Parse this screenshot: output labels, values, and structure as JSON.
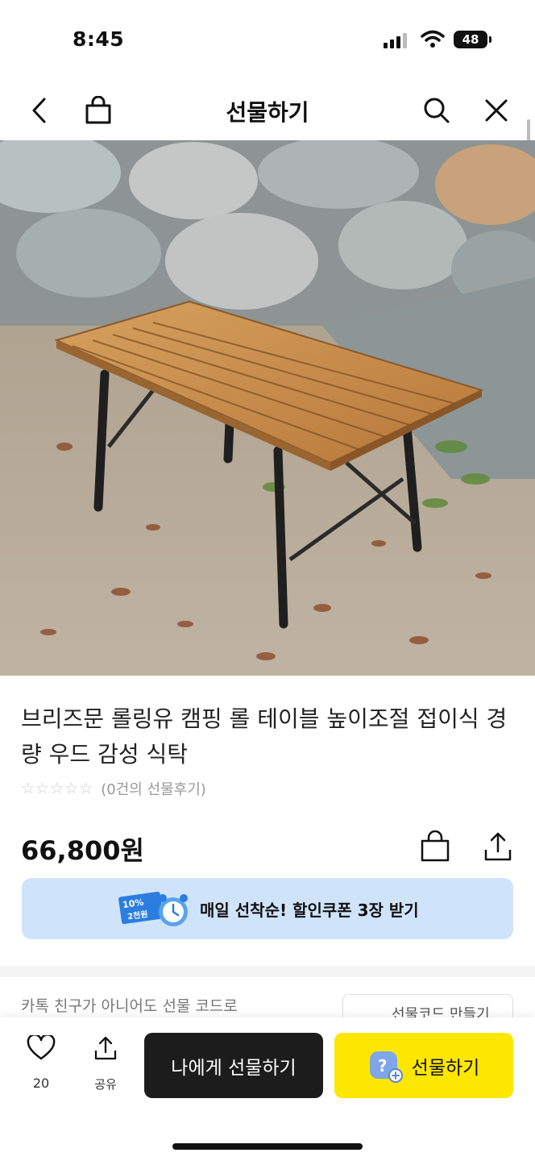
{
  "status": {
    "time": "8:45",
    "battery": "48"
  },
  "nav": {
    "title": "선물하기"
  },
  "product": {
    "title": "브리즈문 롤링유 캠핑 롤 테이블 높이조절 접이식 경량 우드 감성 식탁",
    "review_text": "(0건의 선물후기)",
    "price": "66,800원",
    "stars": 0
  },
  "coupon": {
    "badge_percent": "10%",
    "badge_amount": "2천원",
    "text": "매일 선착순! 할인쿠폰 3장 받기"
  },
  "gift_code": {
    "text": "카톡 친구가 아니어도 선물 코드로",
    "button_label": "선물코드 만들기"
  },
  "bottom": {
    "like_count": "20",
    "share_label": "공유",
    "self_gift_label": "나에게 선물하기",
    "gift_label": "선물하기"
  },
  "colors": {
    "accent_yellow": "#fde600",
    "coupon_bg": "#cfe4fb",
    "dark_button": "#1c1c1c"
  }
}
